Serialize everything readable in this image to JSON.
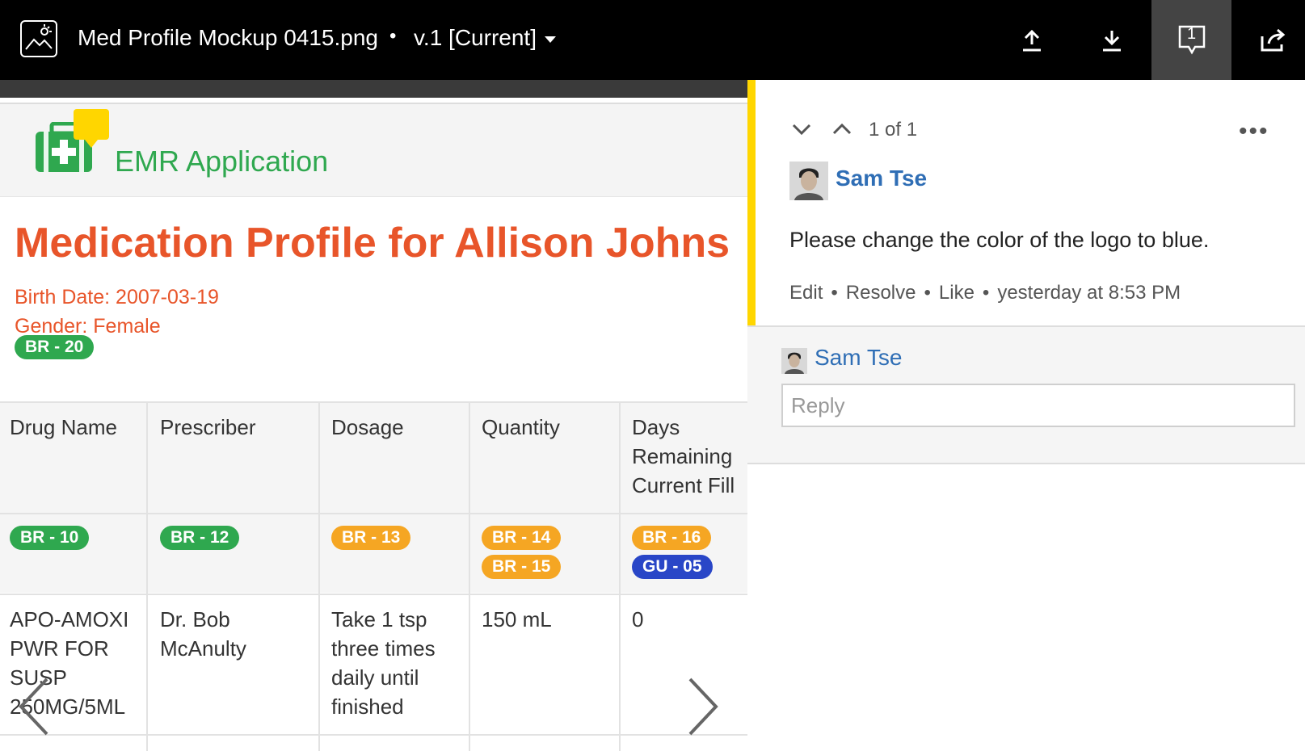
{
  "topbar": {
    "file_title": "Med Profile Mockup 0415.png",
    "separator": "•",
    "version_label": "v.1 [Current]",
    "comment_count": "1"
  },
  "preview": {
    "app_name": "EMR Application",
    "patient_title": "Medication Profile for Allison Johns",
    "birth_date": "Birth Date: 2007-03-19",
    "gender": "Gender: Female",
    "patient_badge": "BR - 20",
    "columns": [
      {
        "header_lines": [
          "Drug Name"
        ],
        "badges": [
          {
            "text": "BR - 10",
            "color": "green"
          }
        ],
        "cell_lines": [
          "APO-AMOXI",
          "PWR FOR",
          "SUSP",
          "250MG/5ML"
        ]
      },
      {
        "header_lines": [
          "Prescriber"
        ],
        "badges": [
          {
            "text": "BR - 12",
            "color": "green"
          }
        ],
        "cell_lines": [
          "Dr. Bob",
          "McAnulty"
        ]
      },
      {
        "header_lines": [
          "Dosage"
        ],
        "badges": [
          {
            "text": "BR - 13",
            "color": "orange"
          }
        ],
        "cell_lines": [
          "Take 1 tsp",
          "three times",
          "daily until",
          "finished"
        ]
      },
      {
        "header_lines": [
          "Quantity"
        ],
        "badges": [
          {
            "text": "BR - 14",
            "color": "orange"
          },
          {
            "text": "BR - 15",
            "color": "orange"
          }
        ],
        "cell_lines": [
          "150 mL"
        ]
      },
      {
        "header_lines": [
          "Days",
          "Remaining",
          "Current Fill"
        ],
        "badges": [
          {
            "text": "BR - 16",
            "color": "orange"
          },
          {
            "text": "GU - 05",
            "color": "blue"
          }
        ],
        "cell_lines": [
          "0"
        ]
      }
    ]
  },
  "comments": {
    "pager_text": "1 of 1",
    "author": "Sam Tse",
    "text": "Please change the color of the logo to blue.",
    "actions": {
      "edit": "Edit",
      "resolve": "Resolve",
      "like": "Like",
      "timestamp": "yesterday at 8:53 PM"
    },
    "reply_author": "Sam Tse",
    "reply_placeholder": "Reply"
  },
  "colors": {
    "accent_yellow": "#ffd600",
    "link_blue": "#2f6eb5",
    "emr_green": "#2fa84f",
    "title_orange": "#e8552a",
    "badge_green": "#2fa84f",
    "badge_orange": "#f5a623",
    "badge_blue": "#2946c7"
  }
}
